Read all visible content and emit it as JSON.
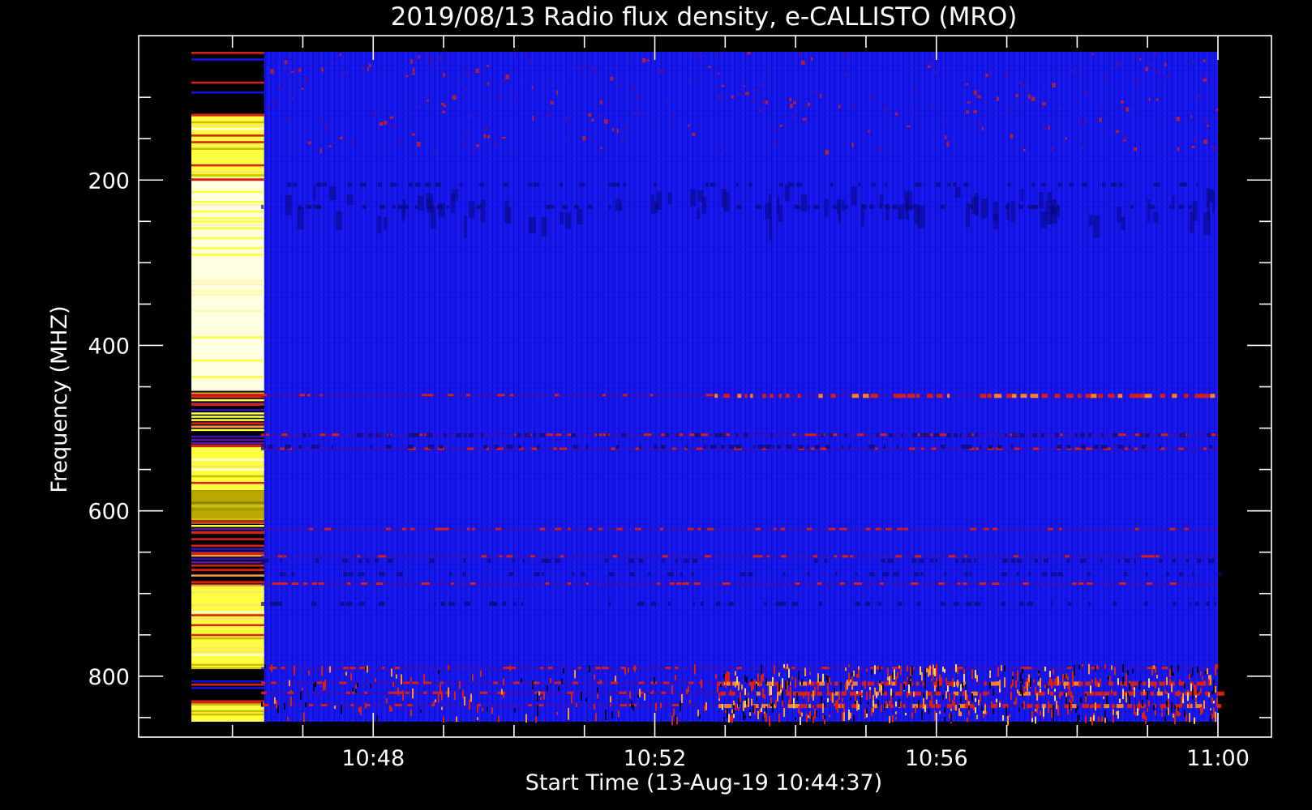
{
  "chart_data": {
    "type": "heatmap",
    "title": "2019/08/13  Radio flux density, e-CALLISTO (MRO)",
    "xlabel": "Start Time (13-Aug-19 10:44:37)",
    "ylabel": "Frequency (MHZ)",
    "x_range": [
      "10:45:25",
      "11:00:00"
    ],
    "y_range": [
      45,
      855
    ],
    "y_inverted": true,
    "x_ticks": [
      "10:48",
      "10:52",
      "10:56",
      "11:00"
    ],
    "y_ticks": [
      200,
      400,
      600,
      800
    ],
    "background_subtracted_start": "10:46:27",
    "colors": {
      "background": "#000000",
      "low": "#1010e8",
      "mid": "#d8201a",
      "high": "#ffff40",
      "peak": "#ffffe0"
    },
    "persistent_emission_bands_mhz": [
      460,
      508,
      525,
      622,
      655,
      688,
      790,
      808,
      820,
      835
    ],
    "raw_segment_bands_mhz": [
      {
        "from": 45,
        "to": 120,
        "level": "dark"
      },
      {
        "from": 120,
        "to": 200,
        "level": "high"
      },
      {
        "from": 200,
        "to": 455,
        "level": "peak"
      },
      {
        "from": 455,
        "to": 520,
        "level": "mixed"
      },
      {
        "from": 520,
        "to": 575,
        "level": "high"
      },
      {
        "from": 575,
        "to": 610,
        "level": "olive"
      },
      {
        "from": 610,
        "to": 690,
        "level": "mixed"
      },
      {
        "from": 690,
        "to": 790,
        "level": "high"
      },
      {
        "from": 790,
        "to": 830,
        "level": "dark"
      },
      {
        "from": 830,
        "to": 855,
        "level": "high"
      }
    ]
  }
}
